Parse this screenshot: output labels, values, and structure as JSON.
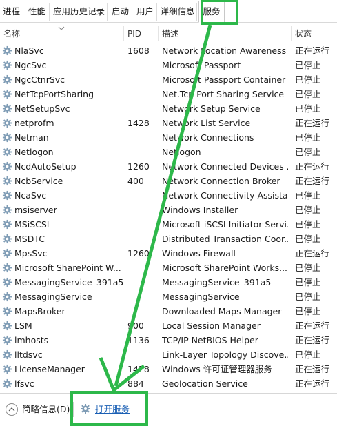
{
  "tabs": [
    {
      "label": "进程"
    },
    {
      "label": "性能"
    },
    {
      "label": "应用历史记录"
    },
    {
      "label": "启动"
    },
    {
      "label": "用户"
    },
    {
      "label": "详细信息"
    },
    {
      "label": "服务",
      "active": true
    }
  ],
  "columns": {
    "name": "名称",
    "pid": "PID",
    "desc": "描述",
    "status": "状态"
  },
  "rows": [
    {
      "name": "NlaSvc",
      "pid": "1608",
      "desc": "Network Location Awareness",
      "status": "正在运行"
    },
    {
      "name": "NgcSvc",
      "pid": "",
      "desc": "Microsoft Passport",
      "status": "已停止"
    },
    {
      "name": "NgcCtnrSvc",
      "pid": "",
      "desc": "Microsoft Passport Container",
      "status": "已停止"
    },
    {
      "name": "NetTcpPortSharing",
      "pid": "",
      "desc": "Net.Tcp Port Sharing Service",
      "status": "已停止"
    },
    {
      "name": "NetSetupSvc",
      "pid": "",
      "desc": "Network Setup Service",
      "status": "已停止"
    },
    {
      "name": "netprofm",
      "pid": "1428",
      "desc": "Network List Service",
      "status": "正在运行"
    },
    {
      "name": "Netman",
      "pid": "",
      "desc": "Network Connections",
      "status": "已停止"
    },
    {
      "name": "Netlogon",
      "pid": "",
      "desc": "Netlogon",
      "status": "已停止"
    },
    {
      "name": "NcdAutoSetup",
      "pid": "1260",
      "desc": "Network Connected Devices ...",
      "status": "正在运行"
    },
    {
      "name": "NcbService",
      "pid": "400",
      "desc": "Network Connection Broker",
      "status": "正在运行"
    },
    {
      "name": "NcaSvc",
      "pid": "",
      "desc": "Network Connectivity Assistant",
      "status": "已停止"
    },
    {
      "name": "msiserver",
      "pid": "",
      "desc": "Windows Installer",
      "status": "已停止"
    },
    {
      "name": "MSiSCSI",
      "pid": "",
      "desc": "Microsoft iSCSI Initiator Servi...",
      "status": "已停止"
    },
    {
      "name": "MSDTC",
      "pid": "",
      "desc": "Distributed Transaction Coor...",
      "status": "已停止"
    },
    {
      "name": "MpsSvc",
      "pid": "1260",
      "desc": "Windows Firewall",
      "status": "正在运行"
    },
    {
      "name": "Microsoft SharePoint W...",
      "pid": "",
      "desc": "Microsoft SharePoint Works...",
      "status": "已停止"
    },
    {
      "name": "MessagingService_391a5",
      "pid": "",
      "desc": "MessagingService_391a5",
      "status": "已停止"
    },
    {
      "name": "MessagingService",
      "pid": "",
      "desc": "MessagingService",
      "status": "已停止"
    },
    {
      "name": "MapsBroker",
      "pid": "",
      "desc": "Downloaded Maps Manager",
      "status": "已停止"
    },
    {
      "name": "LSM",
      "pid": "900",
      "desc": "Local Session Manager",
      "status": "正在运行"
    },
    {
      "name": "lmhosts",
      "pid": "1136",
      "desc": "TCP/IP NetBIOS Helper",
      "status": "正在运行"
    },
    {
      "name": "lltdsvc",
      "pid": "",
      "desc": "Link-Layer Topology Discove...",
      "status": "已停止"
    },
    {
      "name": "LicenseManager",
      "pid": "1428",
      "desc": "Windows 许可证管理器服务",
      "status": "正在运行"
    },
    {
      "name": "lfsvc",
      "pid": "884",
      "desc": "Geolocation Service",
      "status": "正在运行"
    }
  ],
  "footer": {
    "brief_label": "简略信息(D)",
    "open_services_label": "打开服务"
  },
  "colors": {
    "annotation": "#2db84a",
    "link": "#1a5fb4",
    "gear": "#7f9cb5"
  },
  "icons": {
    "service": "gear-icon",
    "collapse": "chevron-up-icon",
    "open_services": "gear-icon"
  }
}
